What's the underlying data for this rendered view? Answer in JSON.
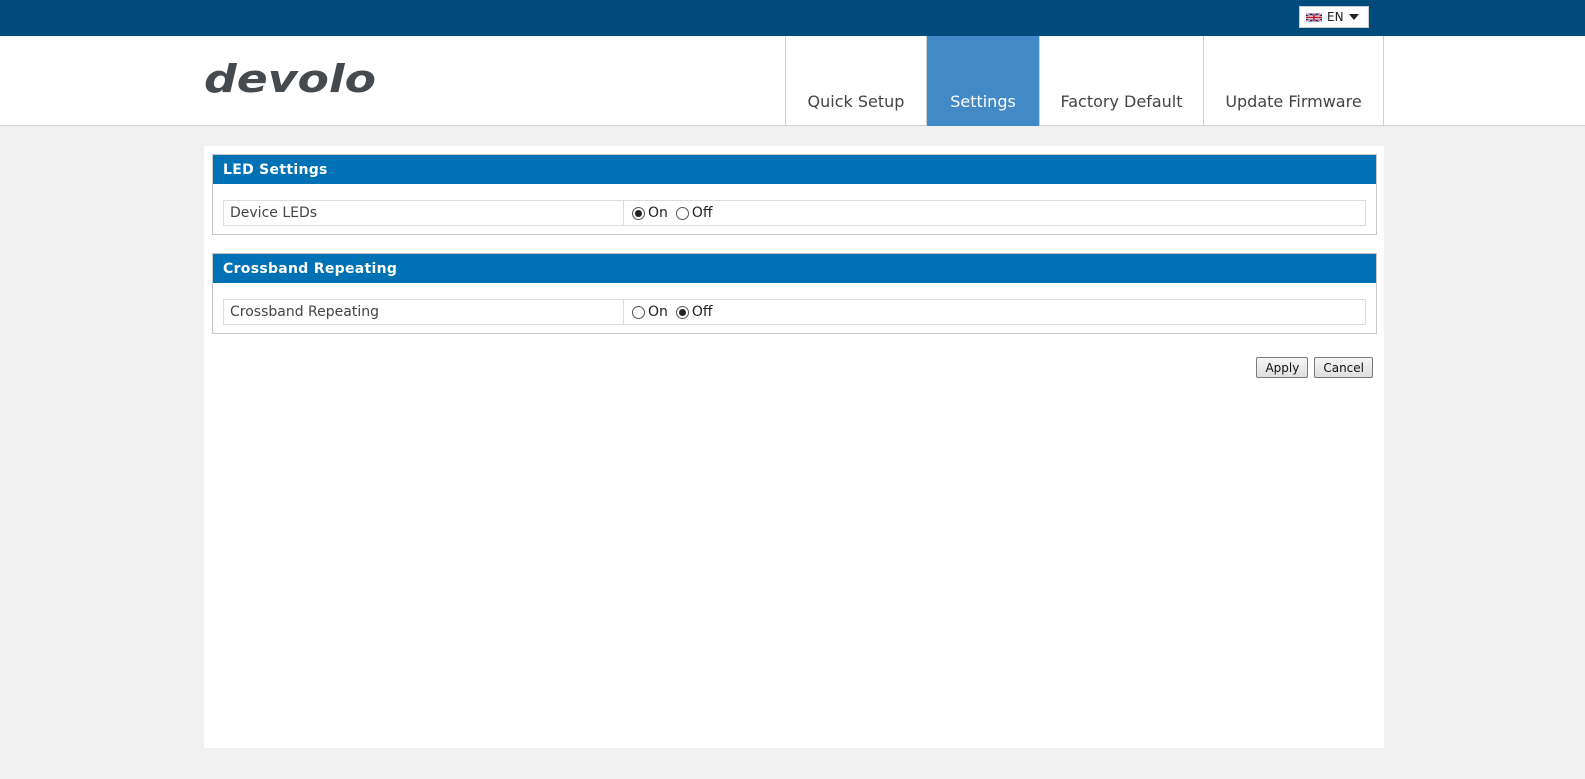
{
  "language": {
    "selected": "EN",
    "flag_icon": "uk-flag-icon"
  },
  "brand": {
    "logo_text": "devolo",
    "logo_color": "#454a4f"
  },
  "nav": {
    "tabs": [
      {
        "label": "Quick Setup",
        "active": false
      },
      {
        "label": "Settings",
        "active": true
      },
      {
        "label": "Factory Default",
        "active": false
      },
      {
        "label": "Update Firmware",
        "active": false
      }
    ]
  },
  "sections": [
    {
      "title": "LED Settings",
      "row_label": "Device LEDs",
      "options": [
        {
          "label": "On",
          "checked": true
        },
        {
          "label": "Off",
          "checked": false
        }
      ]
    },
    {
      "title": "Crossband Repeating",
      "row_label": "Crossband Repeating",
      "options": [
        {
          "label": "On",
          "checked": false
        },
        {
          "label": "Off",
          "checked": true
        }
      ]
    }
  ],
  "actions": {
    "apply_label": "Apply",
    "cancel_label": "Cancel"
  },
  "colors": {
    "top_bar": "#004a7c",
    "active_tab": "#4189c7",
    "section_header": "#0071b5",
    "page_bg": "#f0f0f0"
  }
}
